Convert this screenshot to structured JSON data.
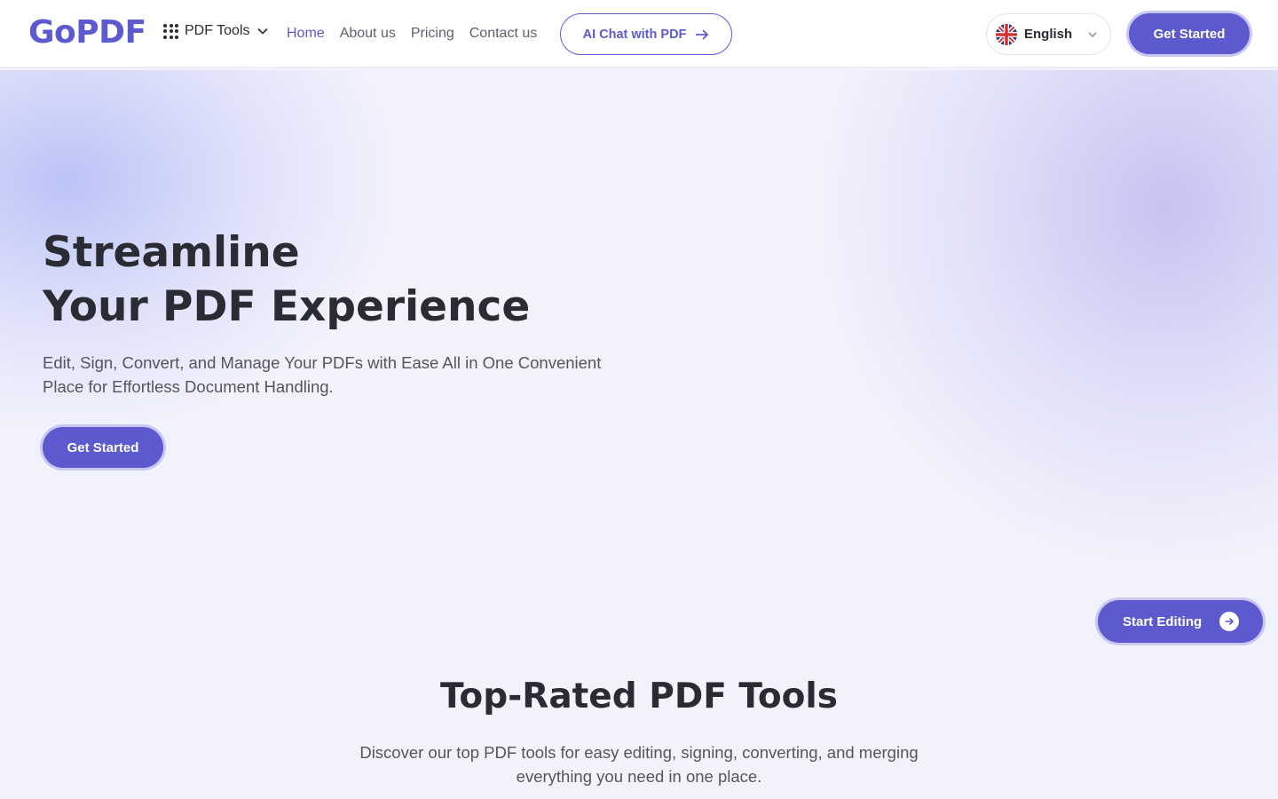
{
  "header": {
    "logo": "GoPDF",
    "tools_label": "PDF Tools",
    "nav": [
      {
        "label": "Home",
        "active": true
      },
      {
        "label": "About us",
        "active": false
      },
      {
        "label": "Pricing",
        "active": false
      },
      {
        "label": "Contact us",
        "active": false
      }
    ],
    "ai_chat_label": "AI Chat with PDF",
    "language": "English",
    "cta_label": "Get Started"
  },
  "hero": {
    "title_line1": "Streamline",
    "title_line2": "Your PDF Experience",
    "subtitle": "Edit, Sign, Convert, and Manage Your PDFs with Ease All in One Convenient Place for Effortless Document Handling.",
    "cta_label": "Get Started",
    "start_editing_label": "Start Editing"
  },
  "section": {
    "title": "Top-Rated PDF Tools",
    "subtitle": "Discover our top PDF tools for easy editing, signing, converting, and merging everything you need in one place."
  },
  "colors": {
    "accent": "#5d59cf",
    "text": "#2b2b33",
    "muted": "#5f5f6b"
  },
  "icons": {
    "tools": "grid-dots-icon",
    "tools_chevron": "chevron-down-icon",
    "ai_chat_arrow": "arrow-right-icon",
    "language_flag": "uk-flag-icon",
    "language_chevron": "chevron-down-icon",
    "start_editing_arrow": "circle-arrow-right-icon"
  }
}
